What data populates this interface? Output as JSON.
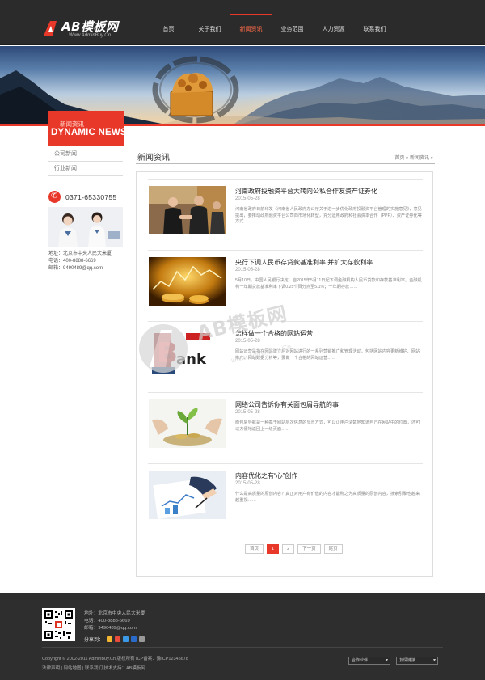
{
  "header": {
    "logo_text": "AB模板网",
    "logo_sub": "Www.AdminBuy.Cn",
    "nav": [
      {
        "label": "首页",
        "active": false
      },
      {
        "label": "关于我们",
        "active": false
      },
      {
        "label": "新闻资讯",
        "active": true
      },
      {
        "label": "业务范围",
        "active": false
      },
      {
        "label": "人力资源",
        "active": false
      },
      {
        "label": "联系我们",
        "active": false
      }
    ]
  },
  "sidebar": {
    "title_cn": "新闻资讯",
    "title_en": "DYNAMIC NEWS",
    "menu": [
      "公司新闻",
      "行业新闻"
    ],
    "phone": "0371-65330755",
    "contact_lines": [
      "地址：北京市中央人民大米厦",
      "电话：400-8888-6669",
      "邮箱：9490489@qq.com"
    ]
  },
  "main": {
    "title": "新闻资讯",
    "breadcrumb": "首页 » 新闻资讯 »",
    "news": [
      {
        "title": "河南政府投融资平台大转向公私合作友资产证券化",
        "date": "2015-05-28",
        "desc": "河南省政府日前印发《河南省人民政府办公厅关于进一步优化政府投融资平台管理的实施意见》，意见提出，要推动政府融资平台公司向市场化转型，充分运用政府和社会资本合作（PPP）、资产证券化等方式……",
        "image": "handshake"
      },
      {
        "title": "央行下调人民币存贷款基准利率 并扩大存款利率",
        "date": "2015-05-28",
        "desc": "5月10日，中国人民银行决定，自2015年5月11日起下调金融机构人民币贷款和存款基准利率。金融机构一年期贷款基准利率下调0.25个百分点至5.1%；一年期存款……",
        "image": "coins"
      },
      {
        "title": "怎样做一个合格的网站运营",
        "date": "2015-05-28",
        "desc": "网站运营是指在网站建立后对网站进行的一系列营销推广和管理活动，包括网站内容更新维护、网站推广、网站数据分析等，要做一个合格的网站运营……",
        "image": "bank"
      },
      {
        "title": "网络公司告诉你有关面包屑导航的事",
        "date": "2015-05-28",
        "desc": "面包屑导航是一种基于网站层次信息的显示方式，可以让用户清楚地知道自己在网站中的位置，还可以方便地返回上一级页面……",
        "image": "plant"
      },
      {
        "title": "内容优化之有“心”创作",
        "date": "2015-05-28",
        "desc": "什么是高质量的原创内容？真正对用户有价值的内容才能称之为高质量的原创内容，搜索引擎也越来越重视……",
        "image": "writing"
      }
    ],
    "pager": [
      "首页",
      "1",
      "2",
      "下一页",
      "尾页"
    ]
  },
  "footer": {
    "lines": [
      "地址：北京市中央人民大米厦",
      "电话：400-8888-6669",
      "邮箱：9490489@qq.com"
    ],
    "share_label": "分享到：",
    "copyright": "Copyright © 2002-2011 AdminBuy.Cn 版权所有    ICP备案：豫ICP12345678",
    "links": "法律声明 | 网站地图 | 联系我们          技术支持：AB模板网",
    "select1": "合作伙伴",
    "select2": "友情链接"
  },
  "watermark": {
    "text": "AB模板网",
    "sub": "www.AdminBuy.Cn"
  },
  "colors": {
    "accent": "#e8382a",
    "header_bg": "#2b2b2b",
    "footer_bg": "#2e2e2e"
  }
}
